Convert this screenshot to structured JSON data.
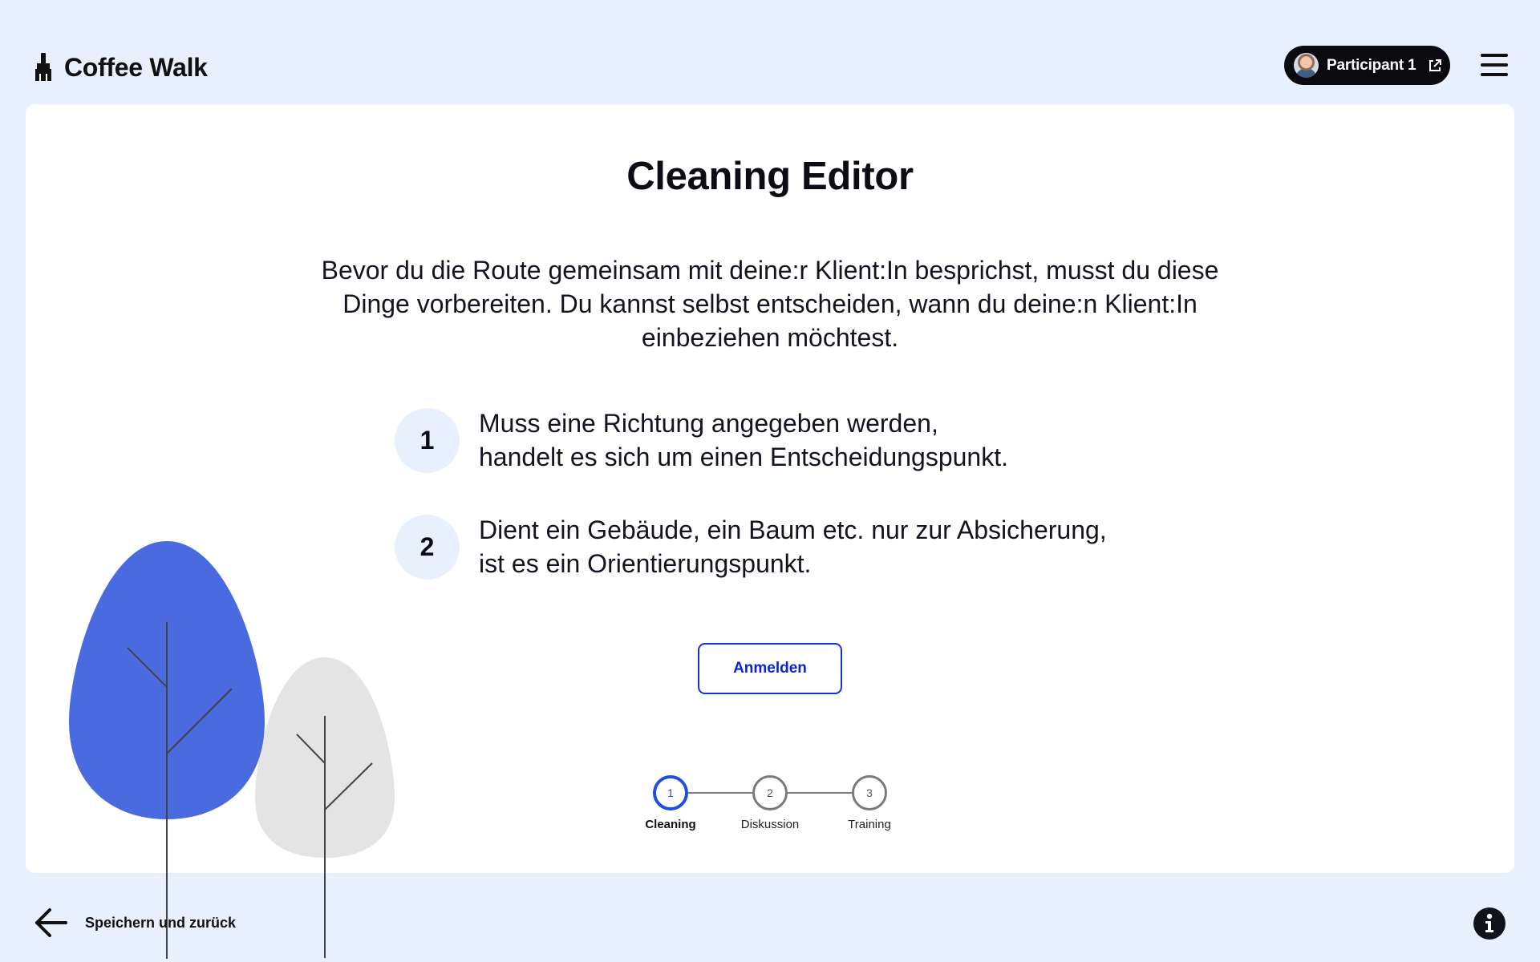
{
  "header": {
    "app_name": "Coffee Walk",
    "logo_icon": "broom-icon",
    "participant_label": "Participant 1",
    "participant_icon": "external-link-icon",
    "menu_icon": "hamburger-menu-icon"
  },
  "main": {
    "title": "Cleaning Editor",
    "intro": "Bevor du die Route gemeinsam mit deine:r Klient:In besprichst, musst du diese Dinge vorbereiten. Du kannst selbst entscheiden, wann du deine:n Klient:In einbeziehen möchtest.",
    "steps": [
      {
        "number": "1",
        "text": "Muss eine Richtung angegeben werden,\nhandelt es sich um einen Entscheidungspunkt."
      },
      {
        "number": "2",
        "text": "Dient ein Gebäude, ein Baum etc. nur zur Absicherung,\nist es ein Orientierungspunkt."
      }
    ],
    "login_label": "Anmelden"
  },
  "stepper": {
    "items": [
      {
        "number": "1",
        "label": "Cleaning",
        "active": true
      },
      {
        "number": "2",
        "label": "Diskussion",
        "active": false
      },
      {
        "number": "3",
        "label": "Training",
        "active": false
      }
    ]
  },
  "footer": {
    "back_label": "Speichern und zurück",
    "back_icon": "arrow-left-icon",
    "info_icon": "info-icon"
  },
  "colors": {
    "background": "#e9f0fd",
    "accent": "#1233d6",
    "tree_blue": "#4a6ae0",
    "tree_gray": "#e4e4e4"
  }
}
